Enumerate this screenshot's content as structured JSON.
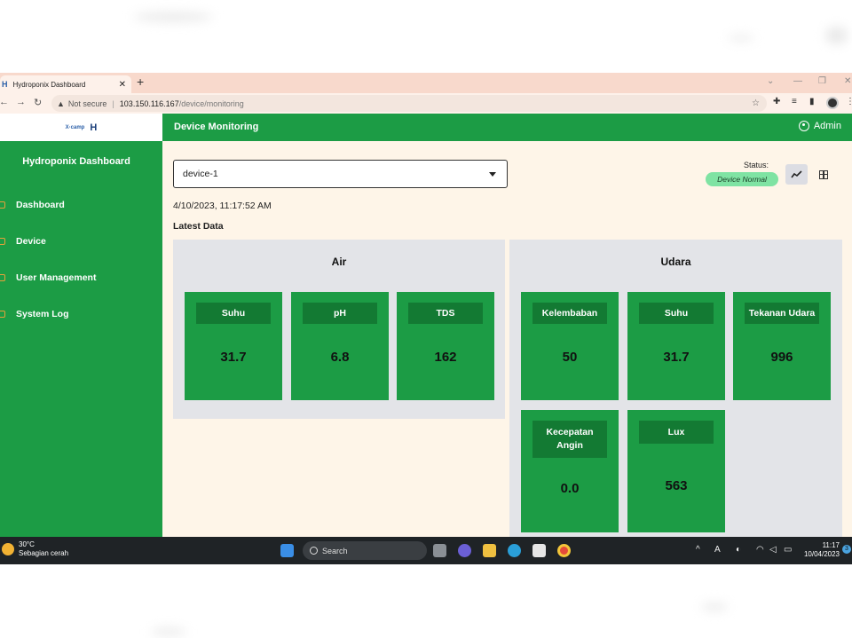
{
  "browser": {
    "tab_title": "Hydroponix Dashboard",
    "url_warning": "Not secure",
    "url_host": "103.150.116.167",
    "url_path": "/device/monitoring"
  },
  "sidebar": {
    "title": "Hydroponix Dashboard",
    "items": [
      {
        "label": "Dashboard"
      },
      {
        "label": "Device"
      },
      {
        "label": "User Management"
      },
      {
        "label": "System Log"
      }
    ]
  },
  "header": {
    "title": "Device Monitoring",
    "user": "Admin"
  },
  "device_select": {
    "value": "device-1"
  },
  "status": {
    "label": "Status:",
    "value": "Device Normal"
  },
  "timestamp": "4/10/2023, 11:17:52 AM",
  "latest_label": "Latest Data",
  "panels": {
    "air": {
      "title": "Air",
      "cards": [
        {
          "label": "Suhu",
          "value": "31.7"
        },
        {
          "label": "pH",
          "value": "6.8"
        },
        {
          "label": "TDS",
          "value": "162"
        }
      ]
    },
    "udara": {
      "title": "Udara",
      "cards": [
        {
          "label": "Kelembaban",
          "value": "50"
        },
        {
          "label": "Suhu",
          "value": "31.7"
        },
        {
          "label": "Tekanan Udara",
          "value": "996"
        },
        {
          "label": "Kecepatan Angin",
          "value": "0.0"
        },
        {
          "label": "Lux",
          "value": "563"
        }
      ]
    }
  },
  "taskbar": {
    "weather_temp": "30°C",
    "weather_desc": "Sebagian cerah",
    "search_label": "Search",
    "time": "11:17",
    "date": "10/04/2023",
    "notification_count": "3"
  },
  "colors": {
    "primary_green": "#1c9c45",
    "label_green": "#137a33",
    "page_bg": "#fef5e8",
    "status_badge": "#7fe3a3"
  }
}
